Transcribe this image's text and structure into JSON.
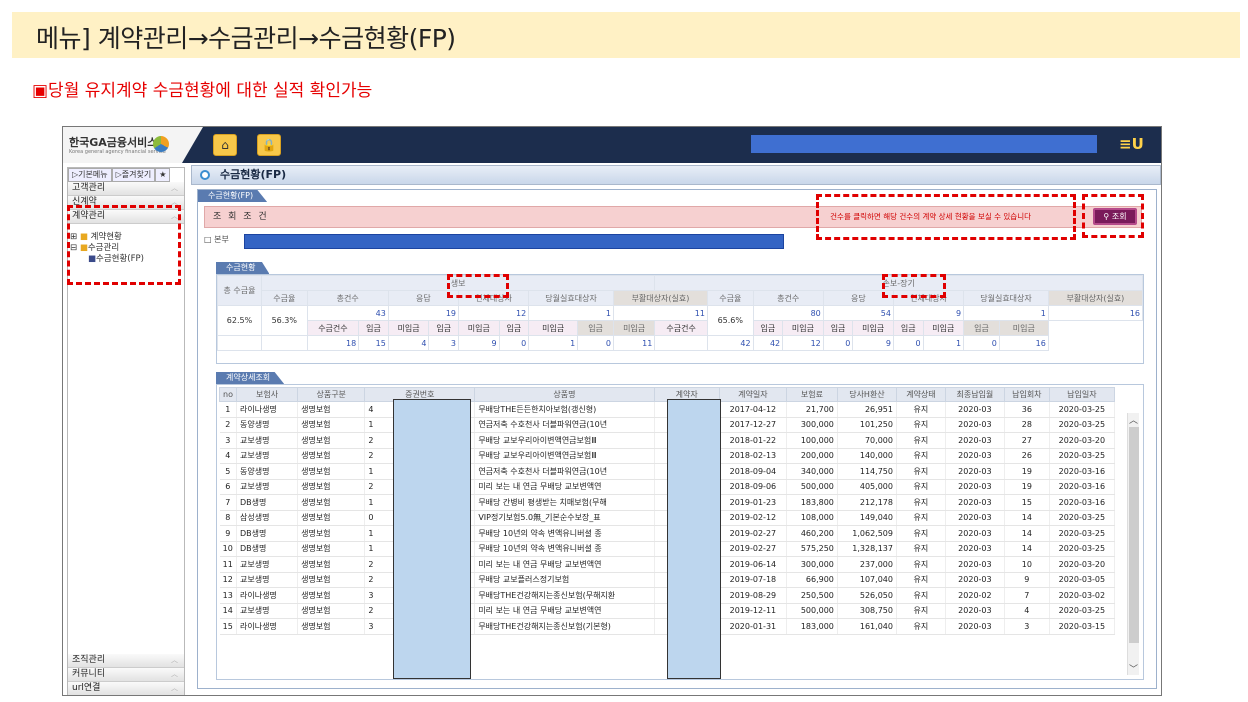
{
  "banner": "메뉴] 계약관리→수금관리→수금현황(FP)",
  "subtitle": "▣당월 유지계약 수금현황에 대한 실적 확인가능",
  "app": {
    "logo": "한국GA금융서비스",
    "logo_sub": "Korea general agency financial service",
    "home_icon": "home-icon",
    "lock_icon": "lock-icon",
    "top_icon": "≡U"
  },
  "sidebar": {
    "tabs": [
      "▷기본메뉴",
      "▷즐겨찾기",
      "★"
    ],
    "items": [
      "고객관리",
      "신계약",
      "계약관리"
    ],
    "tree": [
      "계약현황",
      "수금관리",
      "수금현황(FP)"
    ],
    "bottom": [
      "조직관리",
      "커뮤니티",
      "url연결"
    ]
  },
  "page_title": "수금현황(FP)",
  "panel_tab": "수금현황(FP)",
  "cond": {
    "label": "조 회 조 건",
    "message": "건수를 클릭하면 해당 건수의 계약 상세 현황을 보실 수 있습니다",
    "search": "조회",
    "bonbu": "□ 본부"
  },
  "summary": {
    "tab": "수금현황",
    "total": "총 수금율",
    "life": {
      "group": "생보",
      "headers": [
        "수금율",
        "총건수",
        "응답",
        "연체대상자",
        "당월실효대상자",
        "부활대상자(실효)"
      ],
      "counts": [
        "43",
        "19",
        "12",
        "1",
        "11"
      ],
      "rate1": "62.5%",
      "rate2": "56.3%",
      "sub": [
        "수금건수",
        "입금",
        "미입금",
        "입금",
        "미입금",
        "입금",
        "미입금",
        "입금",
        "미입금"
      ],
      "vals": [
        "18",
        "15",
        "4",
        "3",
        "9",
        "0",
        "1",
        "0",
        "11"
      ]
    },
    "nonlife": {
      "group": "손보-장기",
      "headers": [
        "수금율",
        "총건수",
        "응당",
        "연체대상자",
        "당월실효대상자",
        "부활대상자(실효)"
      ],
      "counts": [
        "80",
        "54",
        "9",
        "1",
        "16"
      ],
      "rate": "65.6%",
      "sub": [
        "수금건수",
        "입금",
        "미입금",
        "입금",
        "미입금",
        "입금",
        "미입금",
        "입금",
        "미입금"
      ],
      "vals": [
        "42",
        "42",
        "12",
        "0",
        "9",
        "0",
        "1",
        "0",
        "16"
      ]
    }
  },
  "detail": {
    "tab": "계약상세조회",
    "headers": [
      "no",
      "보험사",
      "상품구분",
      "증권번호",
      "상품명",
      "계약자",
      "계약일자",
      "보험료",
      "당사H환산",
      "계약상태",
      "최종납입월",
      "납입회차",
      "납입일자"
    ],
    "rows": [
      [
        "1",
        "라이나생명",
        "생명보험",
        "4",
        "무배당THE든든한치아보험(갱신형)",
        "",
        "2017-04-12",
        "21,700",
        "26,951",
        "유지",
        "2020-03",
        "36",
        "2020-03-25"
      ],
      [
        "2",
        "동양생명",
        "생명보험",
        "1",
        "연금저축 수호천사 더블파워연금(10년",
        "",
        "2017-12-27",
        "300,000",
        "101,250",
        "유지",
        "2020-03",
        "28",
        "2020-03-25"
      ],
      [
        "3",
        "교보생명",
        "생명보험",
        "2",
        "무배당 교보우리아이변액연금보험Ⅲ",
        "",
        "2018-01-22",
        "100,000",
        "70,000",
        "유지",
        "2020-03",
        "27",
        "2020-03-20"
      ],
      [
        "4",
        "교보생명",
        "생명보험",
        "2",
        "무배당 교보우리아이변액연금보험Ⅲ",
        "",
        "2018-02-13",
        "200,000",
        "140,000",
        "유지",
        "2020-03",
        "26",
        "2020-03-25"
      ],
      [
        "5",
        "동양생명",
        "생명보험",
        "1",
        "연금저축 수호천사 더블파워연금(10년",
        "",
        "2018-09-04",
        "340,000",
        "114,750",
        "유지",
        "2020-03",
        "19",
        "2020-03-16"
      ],
      [
        "6",
        "교보생명",
        "생명보험",
        "2",
        "미리 보는 내 연금 무배당 교보변액연",
        "",
        "2018-09-06",
        "500,000",
        "405,000",
        "유지",
        "2020-03",
        "19",
        "2020-03-16"
      ],
      [
        "7",
        "DB생명",
        "생명보험",
        "1",
        "무배당 간병비 평생받는 치매보험(무해",
        "",
        "2019-01-23",
        "183,800",
        "212,178",
        "유지",
        "2020-03",
        "15",
        "2020-03-16"
      ],
      [
        "8",
        "삼성생명",
        "생명보험",
        "0",
        "VIP정기보험5.0無_기본순수보장_표",
        "",
        "2019-02-12",
        "108,000",
        "149,040",
        "유지",
        "2020-03",
        "14",
        "2020-03-25"
      ],
      [
        "9",
        "DB생명",
        "생명보험",
        "1",
        "무배당 10년의 약속 변액유니버셜 종",
        "",
        "2019-02-27",
        "460,200",
        "1,062,509",
        "유지",
        "2020-03",
        "14",
        "2020-03-25"
      ],
      [
        "10",
        "DB생명",
        "생명보험",
        "1",
        "무배당 10년의 약속 변액유니버셜 종",
        "",
        "2019-02-27",
        "575,250",
        "1,328,137",
        "유지",
        "2020-03",
        "14",
        "2020-03-25"
      ],
      [
        "11",
        "교보생명",
        "생명보험",
        "2",
        "미리 보는 내 연금 무배당 교보변액연",
        "",
        "2019-06-14",
        "300,000",
        "237,000",
        "유지",
        "2020-03",
        "10",
        "2020-03-20"
      ],
      [
        "12",
        "교보생명",
        "생명보험",
        "2",
        "무배당 교보플러스정기보험",
        "",
        "2019-07-18",
        "66,900",
        "107,040",
        "유지",
        "2020-03",
        "9",
        "2020-03-05"
      ],
      [
        "13",
        "라이나생명",
        "생명보험",
        "3",
        "무배당THE건강해지는종신보험(무해지환",
        "",
        "2019-08-29",
        "250,500",
        "526,050",
        "유지",
        "2020-02",
        "7",
        "2020-03-02"
      ],
      [
        "14",
        "교보생명",
        "생명보험",
        "2",
        "미리 보는 내 연금 무배당 교보변액연",
        "",
        "2019-12-11",
        "500,000",
        "308,750",
        "유지",
        "2020-03",
        "4",
        "2020-03-25"
      ],
      [
        "15",
        "라이나생명",
        "생명보험",
        "3",
        "무배당THE건강해지는종신보험(기본형)",
        "",
        "2020-01-31",
        "183,000",
        "161,040",
        "유지",
        "2020-03",
        "3",
        "2020-03-15"
      ]
    ]
  }
}
